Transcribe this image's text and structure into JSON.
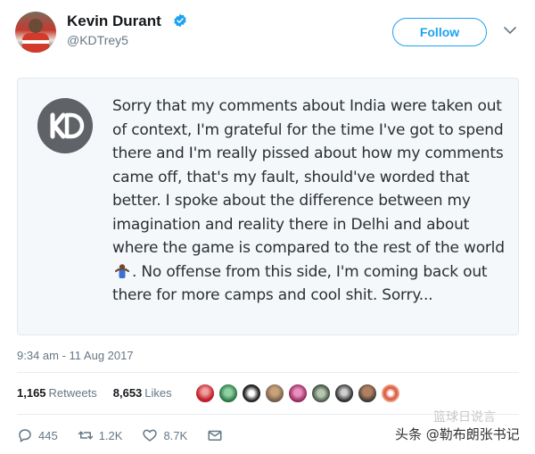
{
  "header": {
    "name": "Kevin Durant",
    "handle": "@KDTrey5",
    "follow_label": "Follow"
  },
  "tweet": {
    "text_part1": "Sorry that my comments about India were taken out of context, I'm grateful for the time I've got to spend there and I'm really pissed about how my comments came off, that's my fault, should've worded that better. I spoke about the difference between my imagination and reality there in Delhi and about where the game is compared to the rest of the world",
    "text_part2": ". No offense from this side, I'm coming back out there for more camps and cool shit. Sorry...",
    "inline_emoji": "person-shrugging-emoji"
  },
  "meta": {
    "timestamp": "9:34 am - 11 Aug 2017"
  },
  "stats": {
    "retweets_count": "1,165",
    "retweets_label": "Retweets",
    "likes_count": "8,653",
    "likes_label": "Likes"
  },
  "actions": {
    "replies": "445",
    "retweets": "1.2K",
    "likes": "8.7K"
  },
  "watermark": {
    "text": "头条 @勒布朗张书记",
    "faint_text": "篮球日说言"
  },
  "colors": {
    "accent": "#1da1f2",
    "text_primary": "#14171a",
    "text_secondary": "#657786",
    "card_bg": "#f5f8fa",
    "border": "#e1e8ed"
  }
}
